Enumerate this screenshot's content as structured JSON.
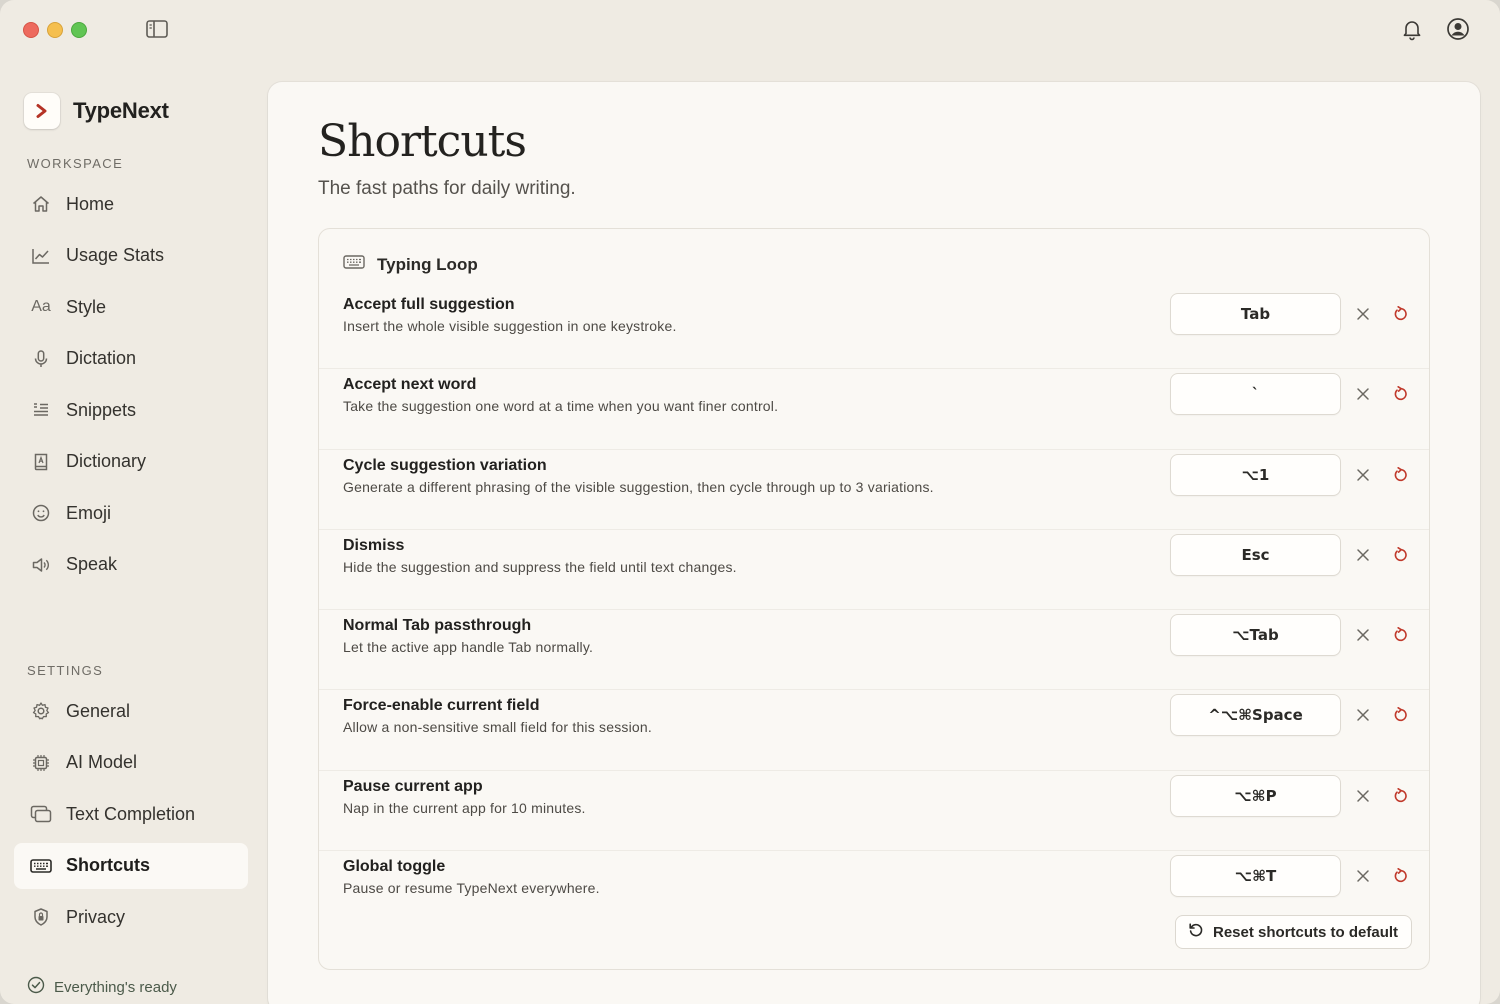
{
  "app": {
    "name": "TypeNext"
  },
  "sidebar": {
    "workspace_label": "WORKSPACE",
    "workspace_items": [
      {
        "label": "Home",
        "icon": "home-icon"
      },
      {
        "label": "Usage Stats",
        "icon": "chart-icon"
      },
      {
        "label": "Style",
        "icon": "text-style-icon"
      },
      {
        "label": "Dictation",
        "icon": "microphone-icon"
      },
      {
        "label": "Snippets",
        "icon": "snippets-icon"
      },
      {
        "label": "Dictionary",
        "icon": "book-icon"
      },
      {
        "label": "Emoji",
        "icon": "smiley-icon"
      },
      {
        "label": "Speak",
        "icon": "speaker-icon"
      }
    ],
    "settings_label": "SETTINGS",
    "settings_items": [
      {
        "label": "General",
        "icon": "gear-icon"
      },
      {
        "label": "AI Model",
        "icon": "chip-icon"
      },
      {
        "label": "Text Completion",
        "icon": "windows-icon"
      },
      {
        "label": "Shortcuts",
        "icon": "keyboard-icon",
        "active": true
      },
      {
        "label": "Privacy",
        "icon": "lock-icon"
      }
    ],
    "status": "Everything's ready"
  },
  "main": {
    "title": "Shortcuts",
    "subtitle": "The fast paths for daily writing.",
    "section": {
      "title": "Typing Loop",
      "shortcuts": [
        {
          "title": "Accept full suggestion",
          "desc": "Insert the whole visible suggestion in one keystroke.",
          "key": "Tab"
        },
        {
          "title": "Accept next word",
          "desc": "Take the suggestion one word at a time when you want finer control.",
          "key": "`"
        },
        {
          "title": "Cycle suggestion variation",
          "desc": "Generate a different phrasing of the visible suggestion, then cycle through up to 3 variations.",
          "key": "⌥1"
        },
        {
          "title": "Dismiss",
          "desc": "Hide the suggestion and suppress the field until text changes.",
          "key": "Esc"
        },
        {
          "title": "Normal Tab passthrough",
          "desc": "Let the active app handle Tab normally.",
          "key": "⌥Tab"
        },
        {
          "title": "Force-enable current field",
          "desc": "Allow a non-sensitive small field for this session.",
          "key": "^⌥⌘Space"
        },
        {
          "title": "Pause current app",
          "desc": "Nap in the current app for 10 minutes.",
          "key": "⌥⌘P"
        },
        {
          "title": "Global toggle",
          "desc": "Pause or resume TypeNext everywhere.",
          "key": "⌥⌘T"
        }
      ],
      "reset_all_label": "Reset shortcuts to default"
    }
  },
  "colors": {
    "accent_red": "#c0392b",
    "status_green": "#4b5a4a"
  }
}
